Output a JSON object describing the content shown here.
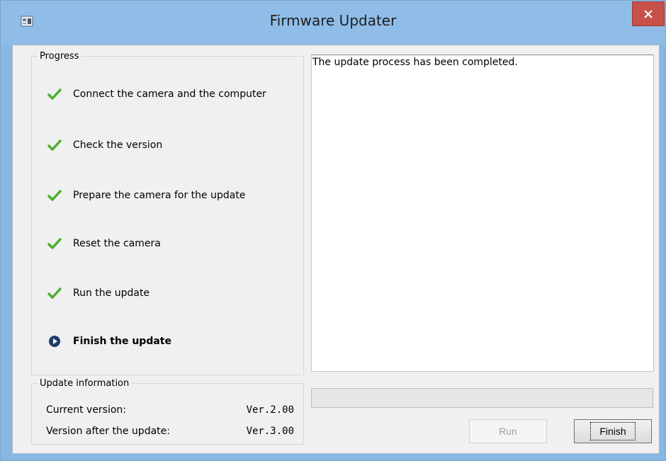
{
  "window": {
    "title": "Firmware Updater",
    "close_label": "×"
  },
  "progress": {
    "legend": "Progress",
    "steps": [
      {
        "label": "Connect the camera and the computer",
        "status": "done"
      },
      {
        "label": "Check the version",
        "status": "done"
      },
      {
        "label": "Prepare the camera for the update",
        "status": "done"
      },
      {
        "label": "Reset the camera",
        "status": "done"
      },
      {
        "label": "Run the update",
        "status": "done"
      },
      {
        "label": "Finish the update",
        "status": "current"
      }
    ]
  },
  "info": {
    "legend": "Update information",
    "current_label": "Current version:",
    "current_value": "Ver.2.00",
    "after_label": "Version after the update:",
    "after_value": "Ver.3.00"
  },
  "log": {
    "text": "The update process has been completed."
  },
  "buttons": {
    "run": "Run",
    "finish": "Finish"
  },
  "colors": {
    "check": "#4caf2e",
    "current": "#1f3b6e",
    "titlebar": "#8fbde8",
    "close": "#c7504b"
  },
  "icons": {
    "done": "checkmark-icon",
    "current": "play-circle-icon"
  }
}
